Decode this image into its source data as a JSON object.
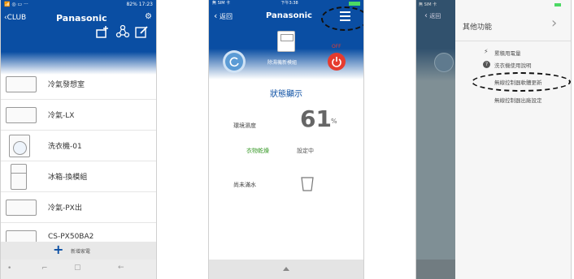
{
  "screen1": {
    "status_left": "📶 ◎ ▭ ···",
    "status_right": "82% 17:23",
    "back_label": "‹CLUB",
    "title": "Panasonic",
    "devices": [
      {
        "label": "冷氣發想室",
        "icon": "ac-unit-icon"
      },
      {
        "label": "冷氣-LX",
        "icon": "ac-unit-icon"
      },
      {
        "label": "洗衣機-01",
        "icon": "washer-icon"
      },
      {
        "label": "冰箱-換模組",
        "icon": "fridge-icon"
      },
      {
        "label": "冷氣-PX出",
        "icon": "ac-unit-icon"
      },
      {
        "label": "CS-PX50BA2",
        "icon": "ac-unit-icon"
      }
    ],
    "add_label": "新增家電",
    "nav_labels": [
      "•",
      "⌐",
      "▢",
      "←"
    ]
  },
  "screen2": {
    "status_left": "無 SIM 卡",
    "status_time": "下午3:38",
    "back_label": "返回",
    "title": "Panasonic",
    "module_label": "除濕機新模組",
    "off_label": "OFF",
    "section_title": "狀態顯示",
    "humidity_label": "環境濕度",
    "humidity_value": "61",
    "humidity_unit": "%",
    "mode_label": "衣物乾燥",
    "mode_value": "設定中",
    "water_label": "尚未滿水",
    "colors": {
      "accent_green": "#3a9a2a",
      "power_red": "#e63b2e",
      "blue": "#0a4ea3"
    }
  },
  "screen3": {
    "status_left": "無 SIM 卡",
    "back_label": "返回",
    "panel_title": "其他功能",
    "menu_items": [
      {
        "label": "累積用電量",
        "icon": "bolt-icon"
      },
      {
        "label": "洗衣機使用說明",
        "icon": "help-icon"
      },
      {
        "label": "無線控制器軟體更新",
        "icon": ""
      },
      {
        "label": "無線控制器出廠設定",
        "icon": ""
      }
    ]
  }
}
